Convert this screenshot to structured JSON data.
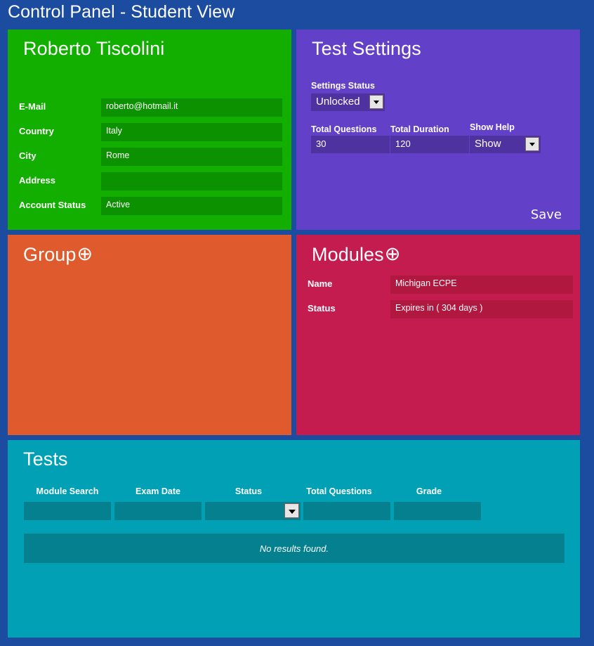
{
  "app": {
    "title": "Control Panel - Student View",
    "background_color": "#1b4ca0"
  },
  "profile": {
    "title": "Roberto Tiscolini",
    "color": "#12ae00",
    "fields": [
      {
        "label": "E-Mail",
        "value": "roberto@hotmail.it"
      },
      {
        "label": "Country",
        "value": "Italy"
      },
      {
        "label": "City",
        "value": "Rome"
      },
      {
        "label": "Address",
        "value": ""
      },
      {
        "label": "Account Status",
        "value": "Active"
      }
    ]
  },
  "test_settings": {
    "title": "Test Settings",
    "color": "#6340c8",
    "settings_status_label": "Settings Status",
    "settings_status_value": "Unlocked",
    "total_questions_label": "Total Questions",
    "total_questions_value": "30",
    "total_duration_label": "Total Duration",
    "total_duration_value": "120",
    "show_help_label": "Show Help",
    "show_help_value": "Show",
    "save_label": "Save"
  },
  "group": {
    "title": "Group",
    "add_icon": "⊕",
    "color": "#df5a2c"
  },
  "modules": {
    "title": "Modules",
    "add_icon": "⊕",
    "color": "#c41c4e",
    "fields": [
      {
        "label": "Name",
        "value": "Michigan ECPE"
      },
      {
        "label": "Status",
        "value": "Expires in ( 304 days )"
      }
    ]
  },
  "tests": {
    "title": "Tests",
    "color": "#02a0b5",
    "columns": [
      {
        "label": "Module Search",
        "value": "",
        "type": "text"
      },
      {
        "label": "Exam Date",
        "value": "",
        "type": "text"
      },
      {
        "label": "Status",
        "value": "",
        "type": "select"
      },
      {
        "label": "Total Questions",
        "value": "",
        "type": "text"
      },
      {
        "label": "Grade",
        "value": "",
        "type": "text"
      }
    ],
    "empty_message": "No results found."
  }
}
